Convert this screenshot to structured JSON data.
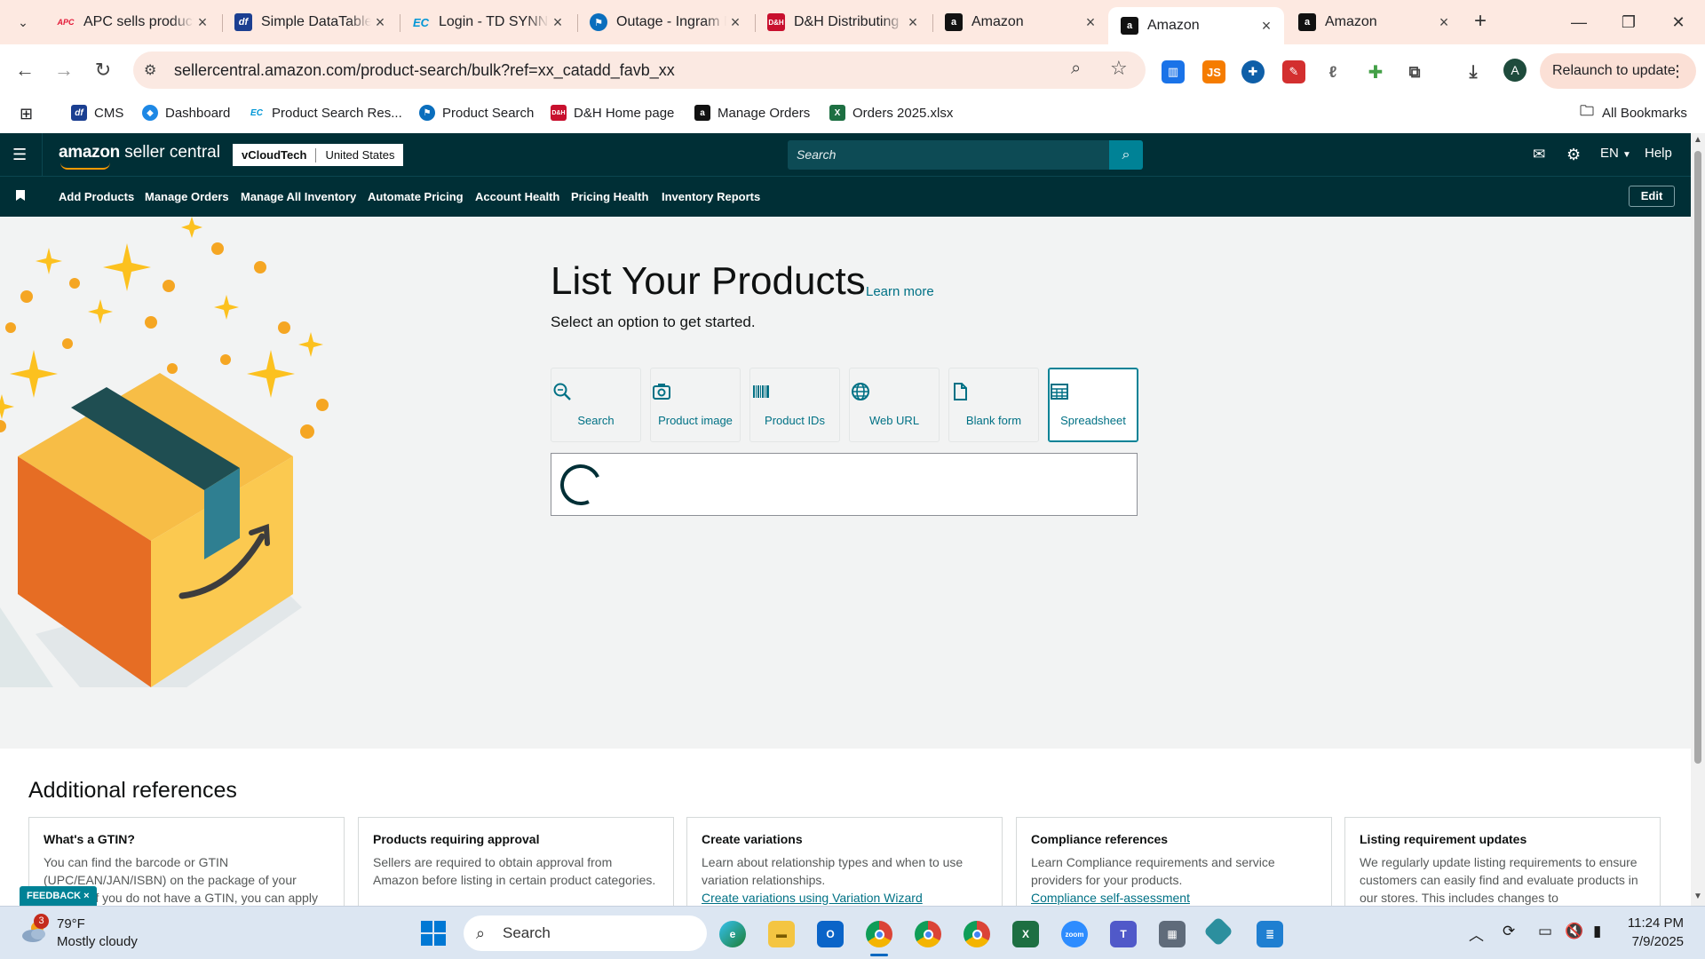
{
  "browser": {
    "tabs": [
      {
        "title": "APC sells products",
        "favicon": "apc-logo",
        "color": "#e31937"
      },
      {
        "title": "Simple DataTables",
        "favicon": "df-logo",
        "color": "#1b3f91"
      },
      {
        "title": "Login - TD SYNNEX",
        "favicon": "ec-logo",
        "color": "#0096d6"
      },
      {
        "title": "Outage - Ingram Micro",
        "favicon": "ingram-logo",
        "color": "#0a6ebd"
      },
      {
        "title": "D&H Distributing",
        "favicon": "dh-logo",
        "color": "#c8102e"
      },
      {
        "title": "Amazon",
        "favicon": "amazon-logo",
        "color": "#111111"
      },
      {
        "title": "Amazon",
        "favicon": "amazon-logo",
        "color": "#111111"
      },
      {
        "title": "Amazon",
        "favicon": "amazon-logo",
        "color": "#111111"
      }
    ],
    "url": "sellercentral.amazon.com/product-search/bulk?ref=xx_catadd_favb_xx",
    "relaunch_label": "Relaunch to update",
    "profile_initial": "A",
    "bookmarks": [
      {
        "label": "CMS",
        "color": "#1b3f91",
        "glyph": "df"
      },
      {
        "label": "Dashboard",
        "color": "#1e88e5",
        "glyph": "◆"
      },
      {
        "label": "Product Search Res...",
        "color": "#0096d6",
        "glyph": "EC"
      },
      {
        "label": "Product Search",
        "color": "#0a6ebd",
        "glyph": "⚑"
      },
      {
        "label": "D&H Home page",
        "color": "#c8102e",
        "glyph": "D&H"
      },
      {
        "label": "Manage Orders",
        "color": "#111111",
        "glyph": "a"
      },
      {
        "label": "Orders 2025.xlsx",
        "color": "#1d6f42",
        "glyph": "X"
      }
    ],
    "all_bookmarks": "All Bookmarks"
  },
  "seller_central": {
    "logo_bold": "amazon",
    "logo_rest": " seller central",
    "account_name": "vCloudTech",
    "marketplace": "United States",
    "search_placeholder": "Search",
    "language": "EN",
    "help": "Help",
    "nav": [
      "Add Products",
      "Manage Orders",
      "Manage All Inventory",
      "Automate Pricing",
      "Account Health",
      "Pricing Health",
      "Inventory Reports"
    ],
    "edit_label": "Edit"
  },
  "main": {
    "title": "List Your Products",
    "learn_more": "Learn more",
    "subtitle": "Select an option to get started.",
    "options": [
      {
        "label": "Search",
        "icon": "search-icon"
      },
      {
        "label": "Product image",
        "icon": "camera-icon"
      },
      {
        "label": "Product IDs",
        "icon": "barcode-icon"
      },
      {
        "label": "Web URL",
        "icon": "globe-icon"
      },
      {
        "label": "Blank form",
        "icon": "document-icon"
      },
      {
        "label": "Spreadsheet",
        "icon": "spreadsheet-icon"
      }
    ],
    "selected_option": "Spreadsheet"
  },
  "references": {
    "title": "Additional references",
    "cards": [
      {
        "title": "What's a GTIN?",
        "body": "You can find the barcode or GTIN (UPC/EAN/JAN/ISBN) on the package of your product. If you do not have a GTIN, you can apply for",
        "link": ""
      },
      {
        "title": "Products requiring approval",
        "body": "Sellers are required to obtain approval from Amazon before listing in certain product categories.",
        "link": ""
      },
      {
        "title": "Create variations",
        "body": "Learn about relationship types and when to use variation relationships.",
        "link": "Create variations using Variation Wizard"
      },
      {
        "title": "Compliance references",
        "body": "Learn Compliance requirements and service providers for your products.",
        "link": "Compliance self-assessment"
      },
      {
        "title": "Listing requirement updates",
        "body": "We regularly update listing requirements to ensure customers can easily find and evaluate products in our stores. This includes changes to",
        "link": ""
      }
    ],
    "feedback_label": "FEEDBACK ×"
  },
  "taskbar": {
    "temperature": "79°F",
    "condition": "Mostly cloudy",
    "weather_badge": "3",
    "search_placeholder": "Search",
    "time": "11:24 PM",
    "date": "7/9/2025"
  }
}
